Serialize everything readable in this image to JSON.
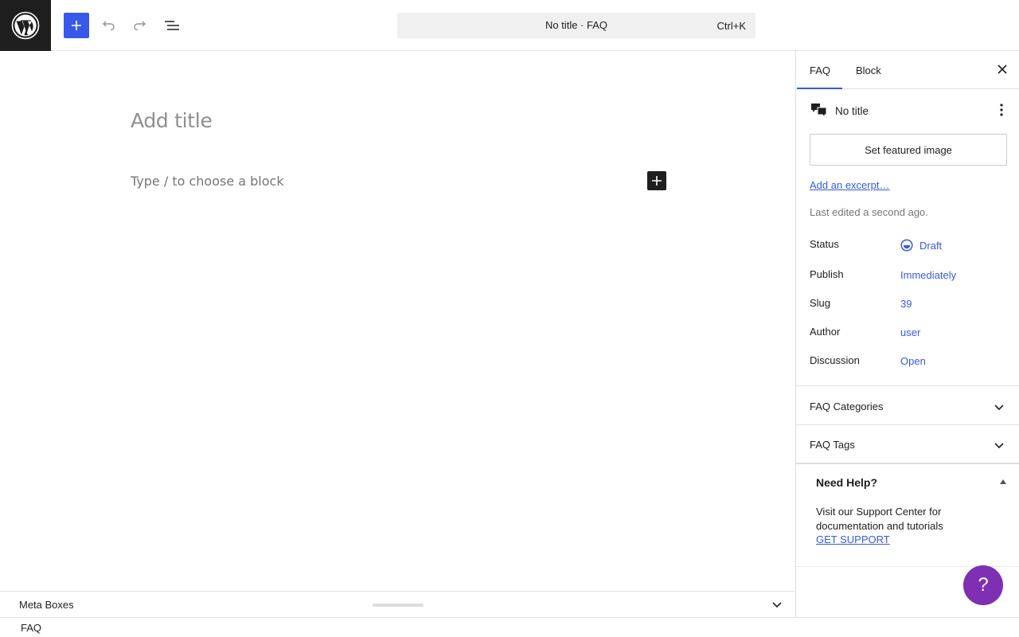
{
  "toolbar": {
    "command_title": "No title · FAQ",
    "command_shortcut": "Ctrl+K",
    "icons": [
      "wordpress-logo",
      "plus-icon",
      "undo-icon",
      "redo-icon",
      "list-view-icon"
    ]
  },
  "editor": {
    "title_placeholder": "Add title",
    "block_placeholder": "Type / to choose a block"
  },
  "meta_boxes": {
    "label": "Meta Boxes"
  },
  "footer": {
    "breadcrumb": "FAQ"
  },
  "sidebar": {
    "tabs": [
      {
        "label": "FAQ",
        "active": true
      },
      {
        "label": "Block",
        "active": false
      }
    ],
    "post_card": {
      "title": "No title",
      "featured_image_button": "Set featured image",
      "excerpt_link": "Add an excerpt…",
      "last_edited": "Last edited a second ago."
    },
    "meta": [
      {
        "label": "Status",
        "value": "Draft"
      },
      {
        "label": "Publish",
        "value": "Immediately"
      },
      {
        "label": "Slug",
        "value": "39"
      },
      {
        "label": "Author",
        "value": "user"
      },
      {
        "label": "Discussion",
        "value": "Open"
      }
    ],
    "panels": [
      {
        "title": "FAQ Categories"
      },
      {
        "title": "FAQ Tags"
      }
    ],
    "help": {
      "title": "Need Help?",
      "text": "Visit our Support Center for documentation and tutorials",
      "link": "GET SUPPORT"
    }
  },
  "help_fab": {
    "label": "?"
  },
  "colors": {
    "accent": "#3858e9",
    "dark": "#1e1e1e",
    "help_fab": "#7e2fb3"
  }
}
